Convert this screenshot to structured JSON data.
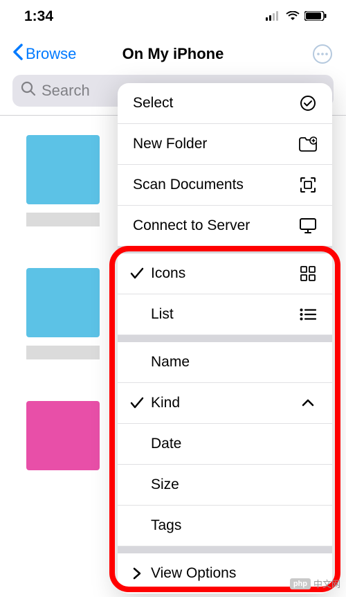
{
  "status": {
    "time": "1:34"
  },
  "nav": {
    "back_label": "Browse",
    "title": "On My iPhone"
  },
  "search": {
    "placeholder": "Search"
  },
  "menu": {
    "top": [
      {
        "label": "Select"
      },
      {
        "label": "New Folder"
      },
      {
        "label": "Scan Documents"
      },
      {
        "label": "Connect to Server"
      }
    ],
    "view": [
      {
        "label": "Icons",
        "checked": true
      },
      {
        "label": "List",
        "checked": false
      }
    ],
    "sort": [
      {
        "label": "Name",
        "checked": false
      },
      {
        "label": "Kind",
        "checked": true
      },
      {
        "label": "Date",
        "checked": false
      },
      {
        "label": "Size",
        "checked": false
      },
      {
        "label": "Tags",
        "checked": false
      }
    ],
    "view_options": "View Options"
  },
  "watermark": {
    "badge": "php",
    "text": "中文网"
  }
}
